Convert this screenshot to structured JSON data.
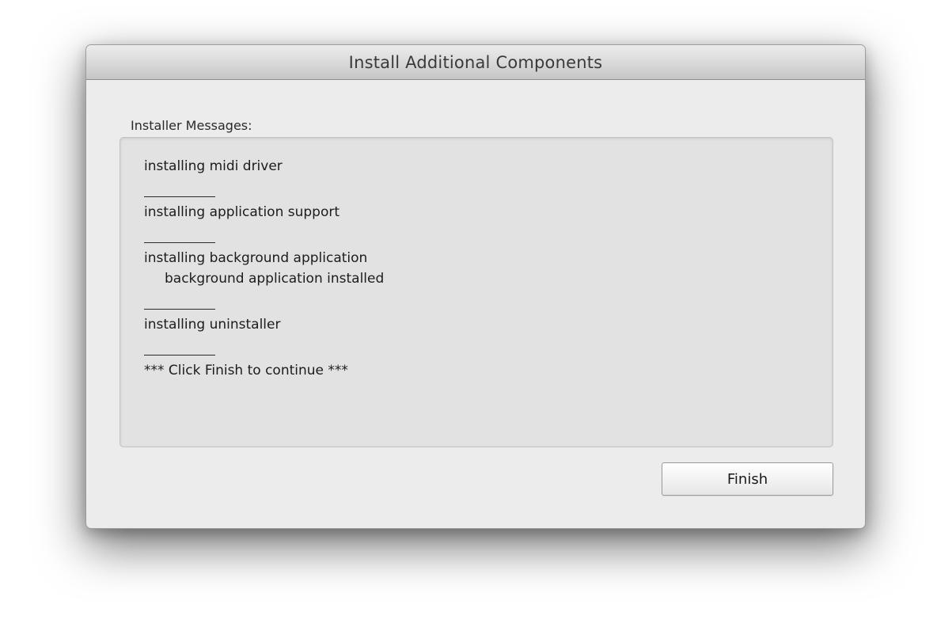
{
  "window": {
    "title": "Install Additional Components"
  },
  "messages": {
    "label": "Installer Messages:",
    "lines": [
      "installing midi driver",
      "installing application support",
      "installing background application",
      "background application installed",
      "installing uninstaller",
      "*** Click Finish to continue ***"
    ]
  },
  "actions": {
    "finish_label": "Finish"
  }
}
